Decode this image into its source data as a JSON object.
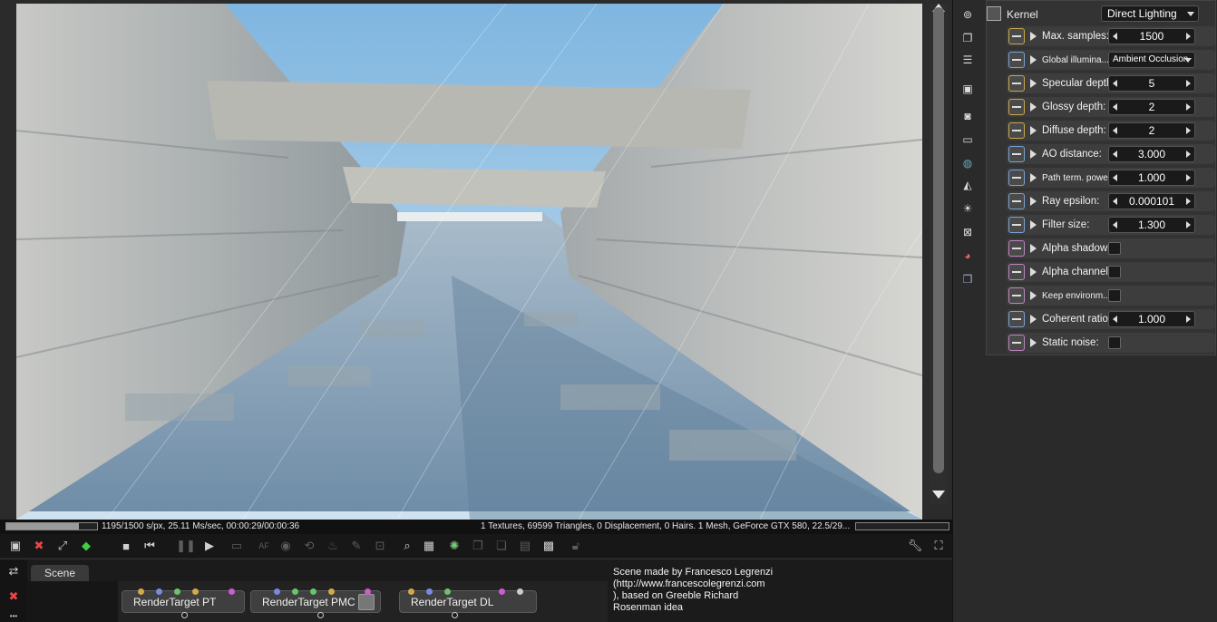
{
  "status": {
    "left_text": "1195/1500 s/px, 25.11 Ms/sec, 00:00:29/00:00:36",
    "right_text": "1 Textures, 69599 Triangles, 0 Displacement, 0 Hairs. 1 Mesh, GeForce GTX 580, 22.5/29...",
    "progress": 0.8
  },
  "toolbar": {
    "icons": [
      "screenshot-icon",
      "clear-icon",
      "fit-icon",
      "color-cube-icon",
      "stop-icon",
      "restart-icon",
      "pause-icon",
      "play-icon",
      "monitor-icon",
      "af-icon",
      "color-wheel-icon",
      "refocus-icon",
      "light-icon",
      "paint-icon",
      "record-icon",
      "search-icon",
      "region-icon",
      "spinner-icon",
      "copy-icon",
      "paste-icon",
      "layers-icon",
      "checker-icon",
      "lock-icon",
      "wrench-icon",
      "fullscreen-icon"
    ]
  },
  "bottom": {
    "tab_label": "Scene",
    "nodes": [
      "RenderTarget PT",
      "RenderTarget PMC",
      "RenderTarget DL"
    ],
    "info_lines": [
      "Scene made by Francesco Legrenzi",
      "(http://www.francescolegrenzi.com",
      "), based on Greeble Richard",
      "Rosenman idea"
    ]
  },
  "kernel": {
    "title": "Kernel",
    "type": "Direct Lighting",
    "rows": [
      {
        "label": "Max. samples:",
        "value": "1500",
        "kind": "spinner",
        "icon": "yellow"
      },
      {
        "label": "Global illumina...",
        "value": "Ambient Occlusion",
        "kind": "dropdown",
        "icon": "blue",
        "small": true
      },
      {
        "label": "Specular depth:",
        "value": "5",
        "kind": "spinner",
        "icon": "yellow"
      },
      {
        "label": "Glossy depth:",
        "value": "2",
        "kind": "spinner",
        "icon": "yellow"
      },
      {
        "label": "Diffuse depth:",
        "value": "2",
        "kind": "spinner",
        "icon": "yellow"
      },
      {
        "label": "AO distance:",
        "value": "3.000",
        "kind": "spinner",
        "icon": "blue"
      },
      {
        "label": "Path term. power:",
        "value": "1.000",
        "kind": "spinner",
        "icon": "blue",
        "small": true
      },
      {
        "label": "Ray epsilon:",
        "value": "0.000101",
        "kind": "spinner",
        "icon": "blue"
      },
      {
        "label": "Filter size:",
        "value": "1.300",
        "kind": "spinner",
        "icon": "blue"
      },
      {
        "label": "Alpha shadows:",
        "value": "",
        "kind": "check",
        "icon": "pink"
      },
      {
        "label": "Alpha channel:",
        "value": "",
        "kind": "check",
        "icon": "pink"
      },
      {
        "label": "Keep environm...",
        "value": "",
        "kind": "check",
        "icon": "pink",
        "small": true
      },
      {
        "label": "Coherent ratio:",
        "value": "1.000",
        "kind": "spinner",
        "icon": "blue"
      },
      {
        "label": "Static noise:",
        "value": "",
        "kind": "check",
        "icon": "pink"
      }
    ]
  },
  "sidebar": {
    "icons": [
      "render-settings-icon",
      "layers-stack-icon",
      "list-icon",
      "image-icon",
      "camera-icon",
      "display-icon",
      "database-icon",
      "environment-icon",
      "sun-icon",
      "kernel-icon",
      "material-icon",
      "cube-icon"
    ]
  }
}
